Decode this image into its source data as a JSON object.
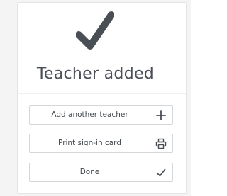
{
  "dialog": {
    "title": "Teacher added",
    "icon": "checkmark-icon"
  },
  "actions": [
    {
      "label": "Add another teacher",
      "icon": "plus-icon"
    },
    {
      "label": "Print sign-in card",
      "icon": "printer-icon"
    },
    {
      "label": "Done",
      "icon": "check-icon"
    }
  ],
  "colors": {
    "icon": "#4a4f55",
    "text": "#44494e",
    "border": "#d4d7da"
  }
}
